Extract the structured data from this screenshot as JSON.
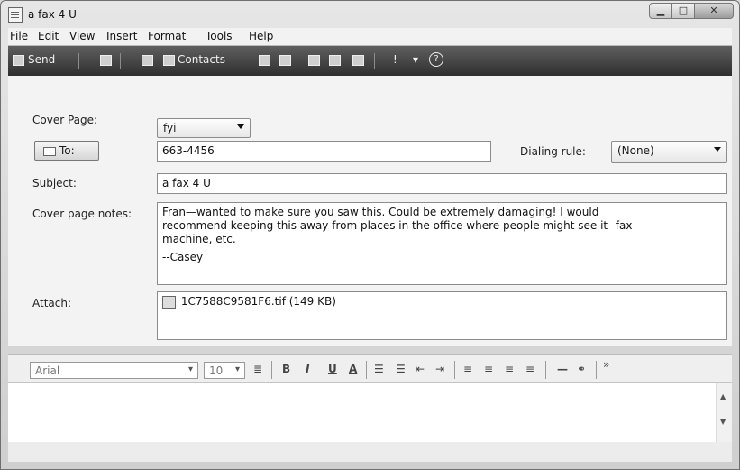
{
  "window": {
    "title": "a fax 4 U"
  },
  "menu": [
    "File",
    "Edit",
    "View",
    "Insert",
    "Format",
    "Tools",
    "Help"
  ],
  "toolbar": {
    "send_label": "Send",
    "contacts_label": "Contacts",
    "priority": "!",
    "help": "?"
  },
  "form": {
    "cover_page_label": "Cover Page:",
    "cover_page_value": "fyi",
    "to_button_label": "To:",
    "to_value": "663-4456",
    "dialing_rule_label": "Dialing rule:",
    "dialing_rule_value": "(None)",
    "subject_label": "Subject:",
    "subject_value": "a fax 4 U",
    "notes_label": "Cover page notes:",
    "notes_line1": "Fran—wanted to make sure you saw this. Could be extremely damaging! I would",
    "notes_line2": "recommend keeping this away from places in the office where people might see it--fax",
    "notes_line3": "machine, etc.",
    "notes_signature": "--Casey",
    "attach_label": "Attach:",
    "attachment": "1C7588C9581F6.tif (149 KB)"
  },
  "format": {
    "font": "Arial",
    "size": "10",
    "bold": "B",
    "italic": "I",
    "underline": "U",
    "color": "A",
    "more": "»"
  }
}
